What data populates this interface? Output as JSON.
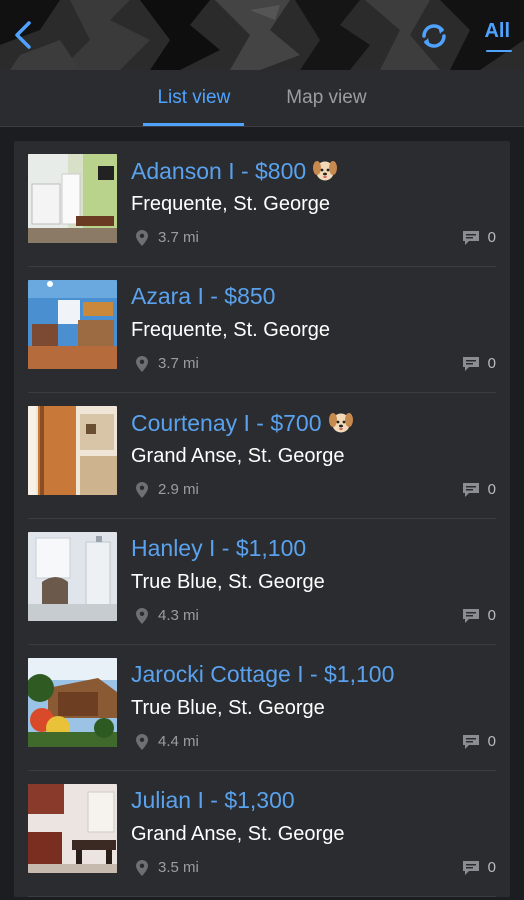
{
  "header": {
    "all_label": "All"
  },
  "tabs": [
    {
      "label": "List view",
      "active": true
    },
    {
      "label": "Map view",
      "active": false
    }
  ],
  "listings": [
    {
      "title": "Adanson I - $800",
      "pet": true,
      "address": "Frequente, St. George",
      "distance": "3.7 mi",
      "comments": "0"
    },
    {
      "title": "Azara I - $850",
      "pet": false,
      "address": "Frequente, St. George",
      "distance": "3.7 mi",
      "comments": "0"
    },
    {
      "title": "Courtenay I - $700",
      "pet": true,
      "address": "Grand Anse, St. George",
      "distance": "2.9 mi",
      "comments": "0"
    },
    {
      "title": "Hanley I - $1,100",
      "pet": false,
      "address": "True Blue, St. George",
      "distance": "4.3 mi",
      "comments": "0"
    },
    {
      "title": "Jarocki Cottage I - $1,100",
      "pet": false,
      "address": "True Blue, St. George",
      "distance": "4.4 mi",
      "comments": "0"
    },
    {
      "title": "Julian I - $1,300",
      "pet": false,
      "address": "Grand Anse, St. George",
      "distance": "3.5 mi",
      "comments": "0"
    }
  ],
  "colors": {
    "accent": "#4fa3ff",
    "title": "#5aa2ee",
    "background": "#1b1d20",
    "card": "#2a2c2f"
  }
}
